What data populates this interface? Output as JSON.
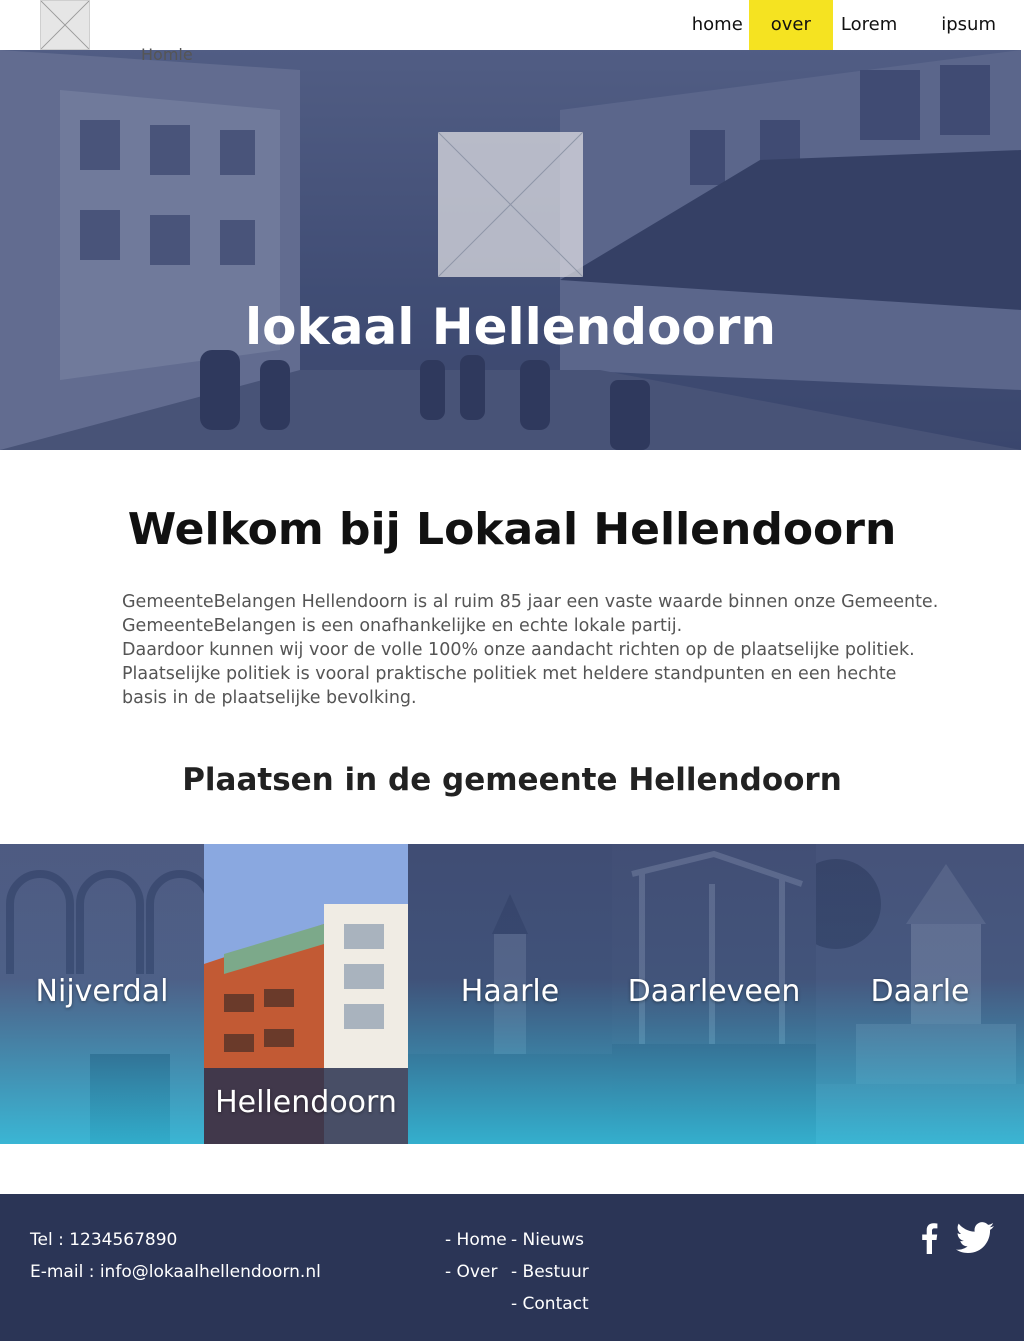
{
  "header": {
    "logo_icon": "placeholder-image-icon",
    "home_label": "Homle",
    "nav": [
      {
        "label": "home"
      },
      {
        "label": "over",
        "active": true
      },
      {
        "label": "Lorem"
      },
      {
        "label": "ipsum"
      }
    ],
    "active_color": "#f5e321"
  },
  "hero": {
    "logo_icon": "placeholder-image-icon",
    "title": "lokaal Hellendoorn"
  },
  "main": {
    "welcome_title": "Welkom bij Lokaal Hellendoorn",
    "intro_lines": [
      "GemeenteBelangen Hellendoorn is al ruim 85 jaar een vaste waarde binnen onze Gemeente.",
      "GemeenteBelangen is een onafhankelijke en echte lokale partij.",
      "Daardoor kunnen wij voor de volle 100% onze aandacht richten op de plaatselijke politiek.",
      "Plaatselijke politiek is vooral praktische politiek met heldere standpunten en een hechte",
      "basis in de plaatselijke bevolking."
    ],
    "places_title": "Plaatsen in de gemeente Hellendoorn"
  },
  "places": [
    {
      "name": "Nijverdal"
    },
    {
      "name": "Hellendoorn",
      "active": true
    },
    {
      "name": "Haarle"
    },
    {
      "name": "Daarleveen"
    },
    {
      "name": "Daarle"
    }
  ],
  "footer": {
    "tel": "Tel : 1234567890",
    "email": "E-mail : info@lokaalhellendoorn.nl",
    "links_col1": [
      "- Home",
      "- Over"
    ],
    "links_col2": [
      "- Nieuws",
      "- Bestuur",
      "- Contact"
    ],
    "social": [
      "facebook-icon",
      "twitter-icon"
    ],
    "background": "#2b3556"
  }
}
